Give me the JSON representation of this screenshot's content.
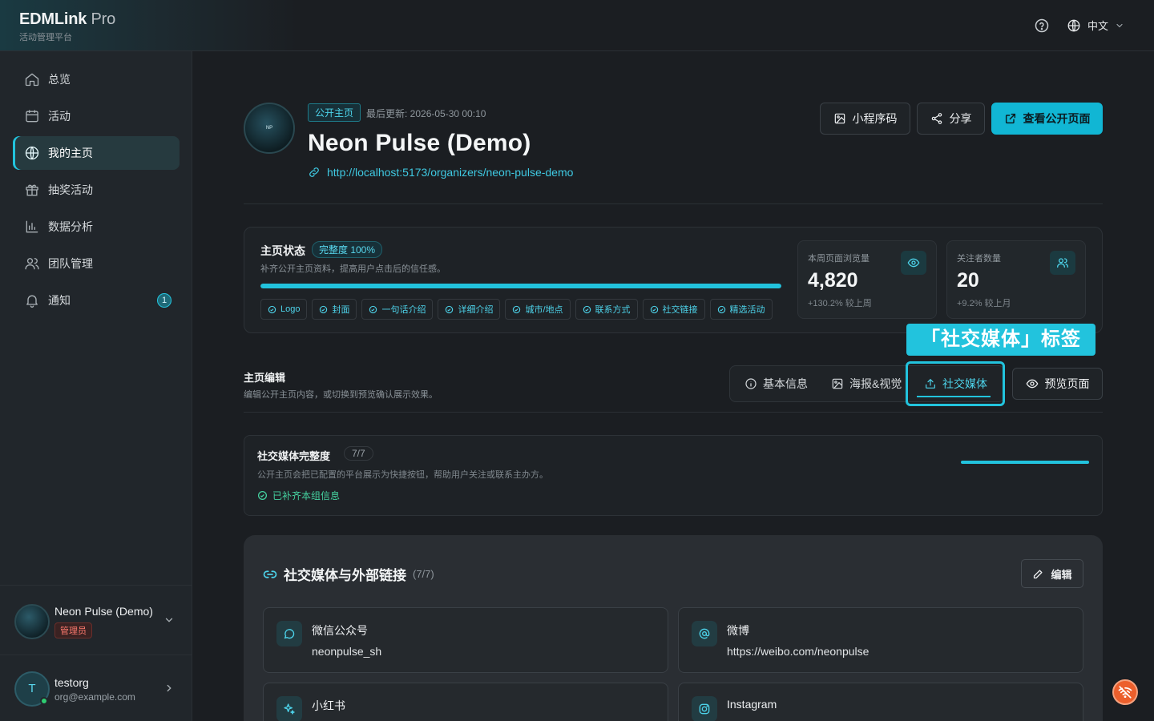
{
  "app": {
    "brand": "EDMLink",
    "brand_suffix": "Pro",
    "subtitle": "活动管理平台"
  },
  "topbar": {
    "language": "中文"
  },
  "sidebar": {
    "items": [
      {
        "label": "总览",
        "icon": "home-icon"
      },
      {
        "label": "活动",
        "icon": "calendar-icon"
      },
      {
        "label": "我的主页",
        "icon": "globe-icon",
        "active": true
      },
      {
        "label": "抽奖活动",
        "icon": "gift-icon"
      },
      {
        "label": "数据分析",
        "icon": "bar-chart-icon"
      },
      {
        "label": "团队管理",
        "icon": "users-icon"
      },
      {
        "label": "通知",
        "icon": "bell-icon",
        "badge": "1"
      }
    ],
    "org": {
      "name": "Neon Pulse (Demo)",
      "role": "管理员"
    },
    "user": {
      "initial": "T",
      "name": "testorg",
      "email": "org@example.com"
    }
  },
  "header": {
    "avatar_text": "NP",
    "public_badge": "公开主页",
    "last_updated": "最后更新: 2026-05-30 00:10",
    "title": "Neon Pulse (Demo)",
    "url": "http://localhost:5173/organizers/neon-pulse-demo",
    "buttons": {
      "miniprogram": "小程序码",
      "share": "分享",
      "view_public": "查看公开页面"
    }
  },
  "status": {
    "title": "主页状态",
    "completeness": "完整度 100%",
    "completeness_value": 1.0,
    "subtitle": "补齐公开主页资料，提高用户点击后的信任感。",
    "chips": [
      "Logo",
      "封面",
      "一句话介绍",
      "详细介绍",
      "城市/地点",
      "联系方式",
      "社交链接",
      "精选活动"
    ],
    "stats": [
      {
        "label": "本周页面浏览量",
        "value": "4,820",
        "delta": "+130.2% 较上周",
        "icon": "eye-icon"
      },
      {
        "label": "关注者数量",
        "value": "20",
        "delta": "+9.2% 较上月",
        "icon": "users-icon"
      }
    ]
  },
  "editor": {
    "title": "主页编辑",
    "subtitle": "编辑公开主页内容，或切换到预览确认展示效果。",
    "tabs": [
      "基本信息",
      "海报&视觉",
      "社交媒体"
    ],
    "preview": "预览页面",
    "callout": "「社交媒体」标签"
  },
  "social_summary": {
    "title": "社交媒体完整度",
    "count": "7/7",
    "completeness_value": 1.0,
    "subtitle": "公开主页会把已配置的平台展示为快捷按钮，帮助用户关注或联系主办方。",
    "status": "已补齐本组信息"
  },
  "links": {
    "title": "社交媒体与外部链接",
    "count": "(7/7)",
    "edit": "编辑",
    "items": [
      {
        "name": "微信公众号",
        "value": "neonpulse_sh",
        "icon": "message-circle-icon"
      },
      {
        "name": "微博",
        "value": "https://weibo.com/neonpulse",
        "icon": "at-sign-icon"
      },
      {
        "name": "小红书",
        "value": "",
        "icon": "sparkles-icon"
      },
      {
        "name": "Instagram",
        "value": "",
        "icon": "instagram-icon"
      }
    ]
  },
  "colors": {
    "accent": "#22c3dd",
    "background": "#1b1e22",
    "sidebar": "#21262b",
    "danger": "#ec5f2c"
  }
}
